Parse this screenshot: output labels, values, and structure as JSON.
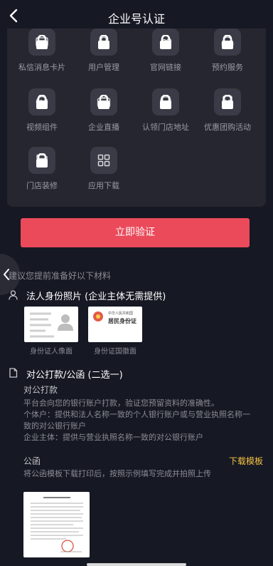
{
  "header": {
    "title": "企业号认证"
  },
  "features": [
    {
      "label": "私信消息卡片",
      "icon": "message-card-icon"
    },
    {
      "label": "用户管理",
      "icon": "user-icon"
    },
    {
      "label": "官网链接",
      "icon": "link-icon"
    },
    {
      "label": "预约服务",
      "icon": "headset-icon"
    },
    {
      "label": "视频组件",
      "icon": "play-icon"
    },
    {
      "label": "企业直播",
      "icon": "live-tv-icon"
    },
    {
      "label": "认领门店地址",
      "icon": "store-icon"
    },
    {
      "label": "优惠团购活动",
      "icon": "coupon-icon"
    },
    {
      "label": "门店装修",
      "icon": "paint-roller-icon"
    },
    {
      "label": "应用下载",
      "icon": "apps-grid-icon"
    }
  ],
  "verify_button": "立即验证",
  "hint": "建议您提前准备好以下材料",
  "section_id": {
    "title": "法人身份照片 (企业主体无需提供)",
    "front_caption": "身份证人像面",
    "back_caption": "身份证国徽面",
    "card_country": "中华人民共和国",
    "card_title": "居民身份证"
  },
  "section_payment": {
    "title": "对公打款/公函 (二选一)",
    "transfer_title": "对公打款",
    "transfer_lines": [
      "平台会向您的银行账户打款，验证您预留资料的准确性。",
      "个体户：提供和法人名称一致的个人银行账户或与营业执照名称一",
      "致的对公银行账户",
      "企业主体：提供与营业执照名称一致的对公银行账户"
    ],
    "letter_title": "公函",
    "download_label": "下载模板",
    "letter_desc": "将公函模板下载打印后，按照示例填写完成并拍照上传"
  },
  "colors": {
    "accent": "#ea4a5a",
    "link": "#f5c344",
    "background": "#161823",
    "panel": "#25262f"
  }
}
